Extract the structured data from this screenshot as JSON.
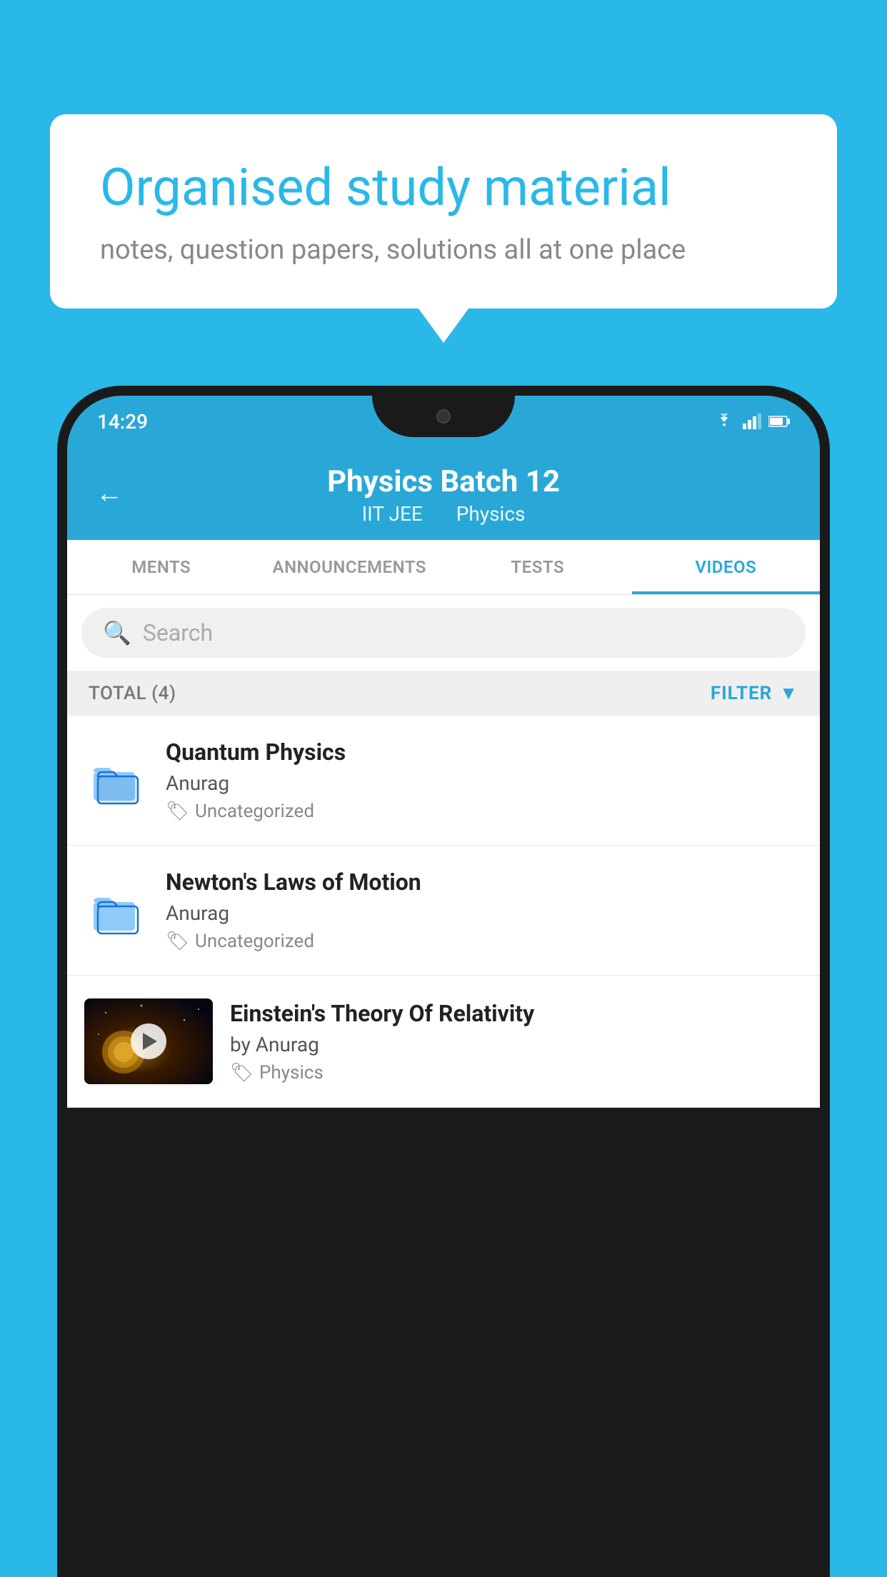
{
  "background": {
    "color": "#29b8e8"
  },
  "speech_bubble": {
    "title": "Organised study material",
    "subtitle": "notes, question papers, solutions all at one place"
  },
  "status_bar": {
    "time": "14:29"
  },
  "app_header": {
    "title": "Physics Batch 12",
    "subtitle_part1": "IIT JEE",
    "subtitle_part2": "Physics",
    "back_label": "←"
  },
  "tabs": [
    {
      "label": "MENTS",
      "active": false
    },
    {
      "label": "ANNOUNCEMENTS",
      "active": false
    },
    {
      "label": "TESTS",
      "active": false
    },
    {
      "label": "VIDEOS",
      "active": true
    }
  ],
  "search": {
    "placeholder": "Search"
  },
  "filter_bar": {
    "total_label": "TOTAL (4)",
    "filter_label": "FILTER"
  },
  "video_list": [
    {
      "id": 1,
      "title": "Quantum Physics",
      "author": "Anurag",
      "tag": "Uncategorized",
      "type": "folder",
      "has_thumbnail": false
    },
    {
      "id": 2,
      "title": "Newton's Laws of Motion",
      "author": "Anurag",
      "tag": "Uncategorized",
      "type": "folder",
      "has_thumbnail": false
    },
    {
      "id": 3,
      "title": "Einstein's Theory Of Relativity",
      "author": "by Anurag",
      "tag": "Physics",
      "type": "video",
      "has_thumbnail": true
    }
  ]
}
